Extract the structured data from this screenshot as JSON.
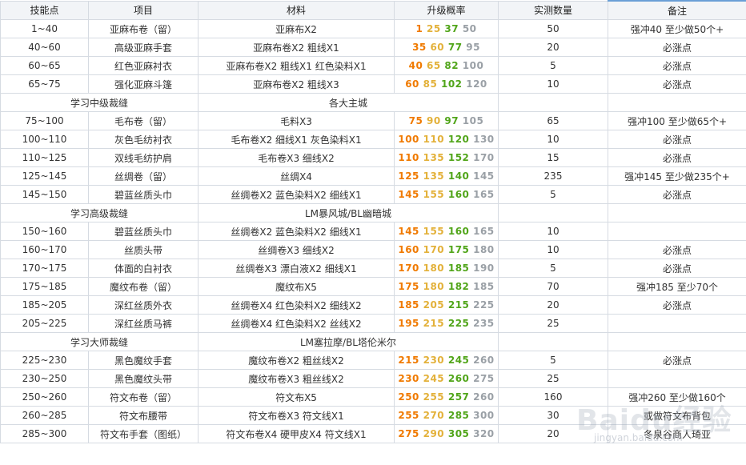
{
  "headers": {
    "skill": "技能点",
    "item": "项目",
    "material": "材料",
    "rate": "升级概率",
    "qty": "实测数量",
    "note": "备注"
  },
  "rows": [
    {
      "type": "row",
      "skill": "1~40",
      "item": "亚麻布卷（留）",
      "material": "亚麻布X2",
      "r": [
        "1",
        "25",
        "37",
        "50"
      ],
      "qty": "50",
      "note": "强冲40 至少做50个+"
    },
    {
      "type": "row",
      "skill": "40~60",
      "item": "高级亚麻手套",
      "material": "亚麻布卷X2 粗线X1",
      "r": [
        "35",
        "60",
        "77",
        "95"
      ],
      "qty": "20",
      "note": "必涨点"
    },
    {
      "type": "row",
      "skill": "60~65",
      "item": "红色亚麻衬衣",
      "material": "亚麻布卷X2 粗线X1 红色染料X1",
      "r": [
        "40",
        "65",
        "82",
        "100"
      ],
      "qty": "5",
      "note": "必涨点"
    },
    {
      "type": "row",
      "skill": "65~75",
      "item": "强化亚麻斗篷",
      "material": "亚麻布卷X2 粗线X3",
      "r": [
        "60",
        "85",
        "102",
        "120"
      ],
      "qty": "10",
      "note": "必涨点"
    },
    {
      "type": "sec",
      "left": "学习中级裁缝",
      "center": "各大主城"
    },
    {
      "type": "row",
      "skill": "75~100",
      "item": "毛布卷（留）",
      "material": "毛料X3",
      "r": [
        "75",
        "90",
        "97",
        "105"
      ],
      "qty": "65",
      "note": "强冲100 至少做65个+"
    },
    {
      "type": "row",
      "skill": "100~110",
      "item": "灰色毛纺衬衣",
      "material": "毛布卷X2 细线X1 灰色染料X1",
      "r": [
        "100",
        "110",
        "120",
        "130"
      ],
      "qty": "10",
      "note": "必涨点"
    },
    {
      "type": "row",
      "skill": "110~125",
      "item": "双线毛纺护肩",
      "material": "毛布卷X3 细线X2",
      "r": [
        "110",
        "135",
        "152",
        "170"
      ],
      "qty": "15",
      "note": "必涨点"
    },
    {
      "type": "row",
      "skill": "125~145",
      "item": "丝绸卷（留）",
      "material": "丝绸X4",
      "r": [
        "125",
        "135",
        "140",
        "145"
      ],
      "qty": "235",
      "note": "强冲145 至少做235个+"
    },
    {
      "type": "row",
      "skill": "145~150",
      "item": "碧蓝丝质头巾",
      "material": "丝绸卷X2 蓝色染料X2 细线X1",
      "r": [
        "145",
        "155",
        "160",
        "165"
      ],
      "qty": "5",
      "note": "必涨点"
    },
    {
      "type": "sec",
      "left": "学习高级裁缝",
      "center": "LM暴风城/BL幽暗城"
    },
    {
      "type": "row",
      "skill": "150~160",
      "item": "碧蓝丝质头巾",
      "material": "丝绸卷X2 蓝色染料X2 细线X1",
      "r": [
        "145",
        "155",
        "160",
        "165"
      ],
      "qty": "10",
      "note": ""
    },
    {
      "type": "row",
      "skill": "160~170",
      "item": "丝质头带",
      "material": "丝绸卷X3 细线X2",
      "r": [
        "160",
        "170",
        "175",
        "180"
      ],
      "qty": "10",
      "note": "必涨点"
    },
    {
      "type": "row",
      "skill": "170~175",
      "item": "体面的白衬衣",
      "material": "丝绸卷X3 漂白液X2 细线X1",
      "r": [
        "170",
        "180",
        "185",
        "190"
      ],
      "qty": "5",
      "note": "必涨点"
    },
    {
      "type": "row",
      "skill": "175~185",
      "item": "魔纹布卷（留）",
      "material": "魔纹布X5",
      "r": [
        "175",
        "180",
        "182",
        "185"
      ],
      "qty": "70",
      "note": "强冲185 至少70个"
    },
    {
      "type": "row",
      "skill": "185~205",
      "item": "深红丝质外衣",
      "material": "丝绸卷X4 红色染料X2 细线X2",
      "r": [
        "185",
        "205",
        "215",
        "225"
      ],
      "qty": "20",
      "note": "必涨点"
    },
    {
      "type": "row",
      "skill": "205~225",
      "item": "深红丝质马裤",
      "material": "丝绸卷X4 红色染料X2 丝线X2",
      "r": [
        "195",
        "215",
        "225",
        "235"
      ],
      "qty": "25",
      "note": ""
    },
    {
      "type": "sec",
      "left": "学习大师裁缝",
      "center": "LM塞拉摩/BL塔伦米尔"
    },
    {
      "type": "row",
      "skill": "225~230",
      "item": "黑色魔纹手套",
      "material": "魔纹布卷X2 粗丝线X2",
      "r": [
        "215",
        "230",
        "245",
        "260"
      ],
      "qty": "5",
      "note": "必涨点"
    },
    {
      "type": "row",
      "skill": "230~250",
      "item": "黑色魔纹头带",
      "material": "魔纹布卷X3 粗丝线X2",
      "r": [
        "230",
        "245",
        "260",
        "275"
      ],
      "qty": "25",
      "note": ""
    },
    {
      "type": "row",
      "skill": "250~260",
      "item": "符文布卷（留）",
      "material": "符文布X5",
      "r": [
        "250",
        "255",
        "257",
        "260"
      ],
      "qty": "160",
      "note": "强冲260 至少做160个"
    },
    {
      "type": "row",
      "skill": "260~285",
      "item": "符文布腰带",
      "material": "符文布卷X3 符文线X1",
      "r": [
        "255",
        "270",
        "285",
        "300"
      ],
      "qty": "30",
      "note": "或做符文布背包"
    },
    {
      "type": "row",
      "skill": "285~300",
      "item": "符文布手套（图纸）",
      "material": "符文布卷X4 硬甲皮X4 符文线X1",
      "r": [
        "275",
        "290",
        "305",
        "320"
      ],
      "qty": "20",
      "note": "冬泉谷商人琦亚"
    }
  ],
  "rate_colors": {
    "orange": "#f07a00",
    "yellow": "#e3b13a",
    "green": "#51a51a",
    "gray": "#9aa0a6"
  },
  "watermark": {
    "text": "Baidu经验",
    "sub": "jingyan.baidu.com"
  }
}
